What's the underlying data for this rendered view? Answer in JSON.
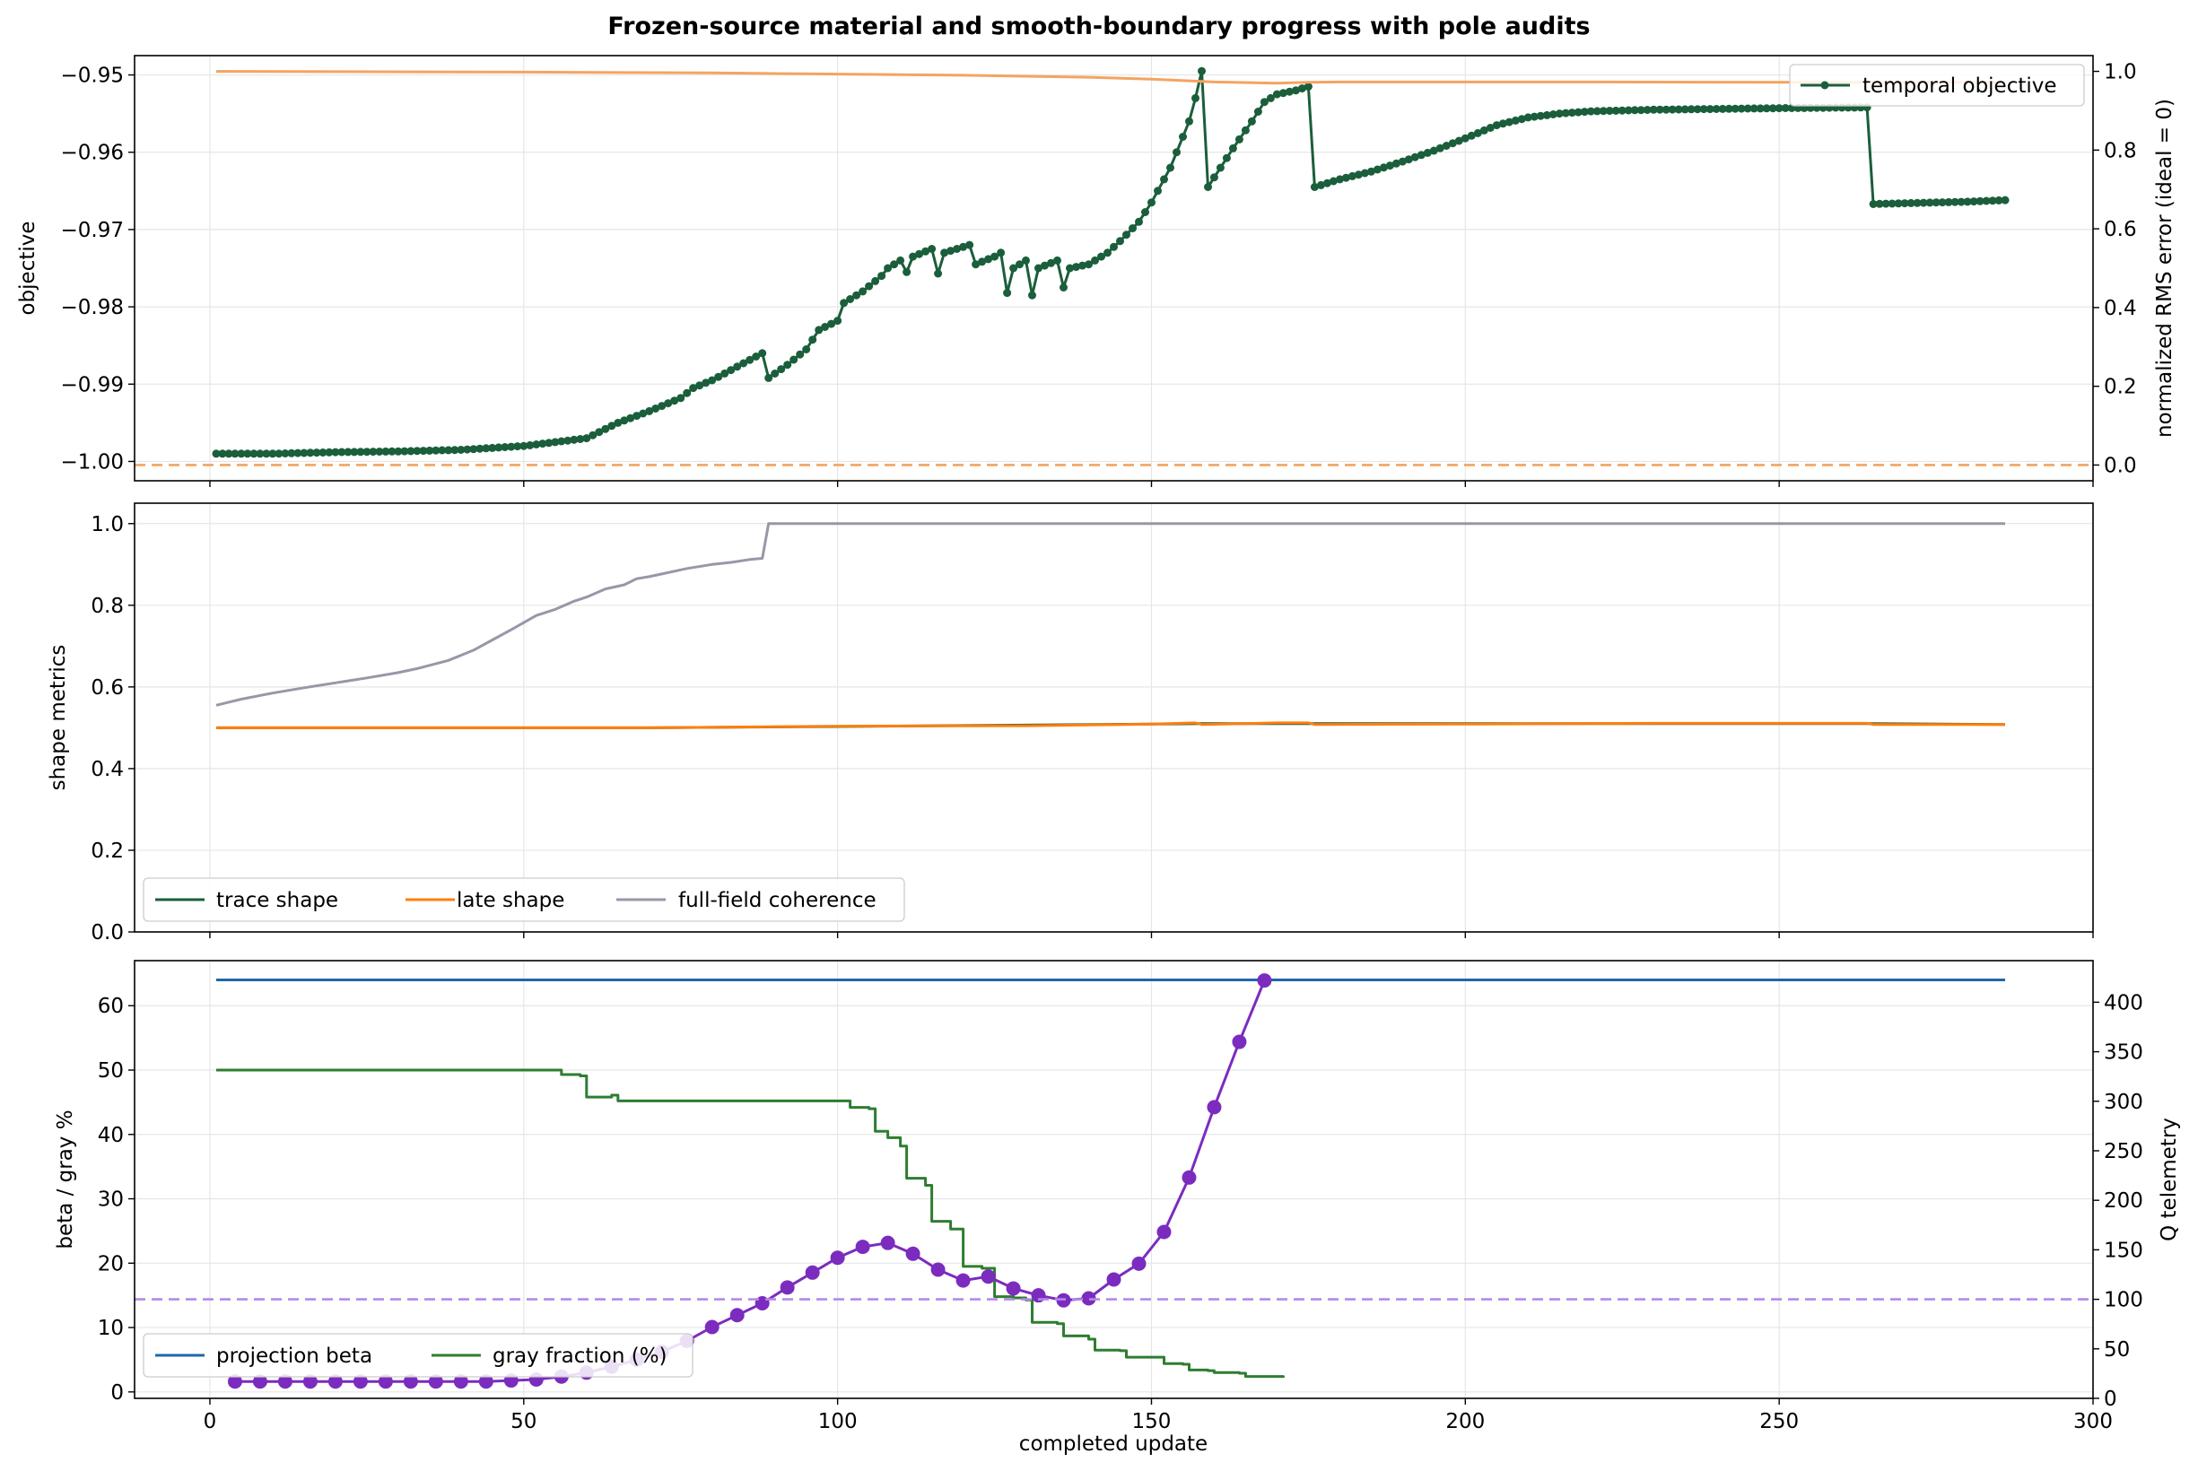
{
  "title": "Frozen-source material and smooth-boundary progress with pole audits",
  "colors": {
    "dark_green": "#1b5e3b",
    "orange": "#ff7f0e",
    "light_orange": "#f4a460",
    "gray": "#9a96a8",
    "blue": "#1f67a8",
    "green": "#2e7d32",
    "purple": "#7b2cbf",
    "light_purple": "#b48ae6"
  },
  "chart_data": [
    {
      "type": "line",
      "panel": "top",
      "xlabel": "",
      "ylabel": "objective",
      "ylabel_right": "normalized RMS error (ideal = 0)",
      "xlim": [
        -12,
        300
      ],
      "ylim": [
        -1.0025,
        -0.9475
      ],
      "ylim_right": [
        -0.04,
        1.04
      ],
      "yticks": [
        -1.0,
        -0.99,
        -0.98,
        -0.97,
        -0.96,
        -0.95
      ],
      "ytick_labels": [
        "−1.00",
        "−0.99",
        "−0.98",
        "−0.97",
        "−0.96",
        "−0.95"
      ],
      "yticks_right": [
        0.0,
        0.2,
        0.4,
        0.6,
        0.8,
        1.0
      ],
      "ytick_labels_right": [
        "0.0",
        "0.2",
        "0.4",
        "0.6",
        "0.8",
        "1.0"
      ],
      "grid": true,
      "legend": {
        "placement": "upper-right",
        "entries": [
          "temporal objective"
        ]
      },
      "series": [
        {
          "name": "temporal objective",
          "axis": "left",
          "style": "line-markers",
          "color": "#1b5e3b",
          "points": [
            [
              1,
              -0.999
            ],
            [
              10,
              -0.999
            ],
            [
              20,
              -0.9988
            ],
            [
              30,
              -0.9987
            ],
            [
              40,
              -0.9985
            ],
            [
              50,
              -0.998
            ],
            [
              55,
              -0.9975
            ],
            [
              60,
              -0.997
            ],
            [
              65,
              -0.995
            ],
            [
              70,
              -0.9935
            ],
            [
              75,
              -0.9918
            ],
            [
              77,
              -0.9905
            ],
            [
              80,
              -0.9895
            ],
            [
              85,
              -0.9873
            ],
            [
              88,
              -0.986
            ],
            [
              89,
              -0.9892
            ],
            [
              92,
              -0.9875
            ],
            [
              95,
              -0.9855
            ],
            [
              97,
              -0.983
            ],
            [
              100,
              -0.9818
            ],
            [
              101,
              -0.9795
            ],
            [
              104,
              -0.978
            ],
            [
              107,
              -0.976
            ],
            [
              108,
              -0.975
            ],
            [
              110,
              -0.974
            ],
            [
              111,
              -0.9755
            ],
            [
              112,
              -0.9735
            ],
            [
              115,
              -0.9725
            ],
            [
              116,
              -0.9757
            ],
            [
              117,
              -0.973
            ],
            [
              121,
              -0.972
            ],
            [
              122,
              -0.9745
            ],
            [
              125,
              -0.9735
            ],
            [
              126,
              -0.973
            ],
            [
              127,
              -0.9782
            ],
            [
              128,
              -0.975
            ],
            [
              130,
              -0.974
            ],
            [
              131,
              -0.9785
            ],
            [
              132,
              -0.975
            ],
            [
              135,
              -0.974
            ],
            [
              136,
              -0.9775
            ],
            [
              137,
              -0.975
            ],
            [
              140,
              -0.9745
            ],
            [
              143,
              -0.973
            ],
            [
              145,
              -0.9715
            ],
            [
              148,
              -0.969
            ],
            [
              150,
              -0.9665
            ],
            [
              153,
              -0.962
            ],
            [
              156,
              -0.956
            ],
            [
              157,
              -0.953
            ],
            [
              158,
              -0.9495
            ],
            [
              159,
              -0.9645
            ],
            [
              161,
              -0.962
            ],
            [
              163,
              -0.9595
            ],
            [
              166,
              -0.956
            ],
            [
              168,
              -0.9535
            ],
            [
              170,
              -0.9525
            ],
            [
              173,
              -0.952
            ],
            [
              175,
              -0.9515
            ],
            [
              176,
              -0.9645
            ],
            [
              180,
              -0.9635
            ],
            [
              185,
              -0.9625
            ],
            [
              190,
              -0.9612
            ],
            [
              195,
              -0.9598
            ],
            [
              200,
              -0.9582
            ],
            [
              205,
              -0.9565
            ],
            [
              210,
              -0.9555
            ],
            [
              215,
              -0.955
            ],
            [
              220,
              -0.9547
            ],
            [
              230,
              -0.9545
            ],
            [
              240,
              -0.9544
            ],
            [
              250,
              -0.9543
            ],
            [
              264,
              -0.9542
            ],
            [
              265,
              -0.9667
            ],
            [
              270,
              -0.9666
            ],
            [
              280,
              -0.9664
            ],
            [
              286,
              -0.9662
            ]
          ]
        },
        {
          "name": "",
          "axis": "right",
          "style": "line",
          "color": "#f4a460",
          "points": [
            [
              1,
              1.0
            ],
            [
              50,
              0.998
            ],
            [
              80,
              0.996
            ],
            [
              100,
              0.993
            ],
            [
              120,
              0.99
            ],
            [
              140,
              0.985
            ],
            [
              150,
              0.98
            ],
            [
              160,
              0.973
            ],
            [
              170,
              0.97
            ],
            [
              175,
              0.972
            ],
            [
              180,
              0.973
            ],
            [
              220,
              0.973
            ],
            [
              265,
              0.972
            ],
            [
              286,
              0.972
            ]
          ]
        },
        {
          "name": "",
          "axis": "right",
          "style": "dashed-hline",
          "color": "#f4a460",
          "value": 0.0
        }
      ]
    },
    {
      "type": "line",
      "panel": "middle",
      "xlabel": "",
      "ylabel": "shape metrics",
      "xlim": [
        -12,
        300
      ],
      "ylim": [
        0.0,
        1.05
      ],
      "yticks": [
        0.0,
        0.2,
        0.4,
        0.6,
        0.8,
        1.0
      ],
      "ytick_labels": [
        "0.0",
        "0.2",
        "0.4",
        "0.6",
        "0.8",
        "1.0"
      ],
      "grid": true,
      "legend": {
        "placement": "lower-left",
        "entries": [
          "trace shape",
          "late shape",
          "full-field coherence"
        ]
      },
      "series": [
        {
          "name": "trace shape",
          "color": "#1b5e3b",
          "points": [
            [
              1,
              0.5
            ],
            [
              70,
              0.5
            ],
            [
              100,
              0.503
            ],
            [
              158,
              0.51
            ],
            [
              175,
              0.51
            ],
            [
              264,
              0.51
            ],
            [
              286,
              0.508
            ]
          ]
        },
        {
          "name": "late shape",
          "color": "#ff7f0e",
          "points": [
            [
              1,
              0.5
            ],
            [
              70,
              0.5
            ],
            [
              100,
              0.504
            ],
            [
              130,
              0.505
            ],
            [
              150,
              0.509
            ],
            [
              157,
              0.512
            ],
            [
              158,
              0.508
            ],
            [
              170,
              0.512
            ],
            [
              175,
              0.512
            ],
            [
              176,
              0.508
            ],
            [
              200,
              0.509
            ],
            [
              230,
              0.511
            ],
            [
              264,
              0.511
            ],
            [
              265,
              0.508
            ],
            [
              286,
              0.508
            ]
          ]
        },
        {
          "name": "full-field coherence",
          "color": "#9a96a8",
          "points": [
            [
              1,
              0.555
            ],
            [
              5,
              0.57
            ],
            [
              10,
              0.585
            ],
            [
              15,
              0.598
            ],
            [
              20,
              0.61
            ],
            [
              25,
              0.622
            ],
            [
              30,
              0.635
            ],
            [
              33,
              0.645
            ],
            [
              38,
              0.665
            ],
            [
              42,
              0.69
            ],
            [
              45,
              0.715
            ],
            [
              48,
              0.74
            ],
            [
              52,
              0.775
            ],
            [
              55,
              0.79
            ],
            [
              58,
              0.81
            ],
            [
              60,
              0.82
            ],
            [
              63,
              0.84
            ],
            [
              66,
              0.85
            ],
            [
              68,
              0.865
            ],
            [
              70,
              0.87
            ],
            [
              73,
              0.88
            ],
            [
              76,
              0.89
            ],
            [
              80,
              0.9
            ],
            [
              83,
              0.905
            ],
            [
              86,
              0.912
            ],
            [
              88,
              0.915
            ],
            [
              89,
              1.0
            ],
            [
              286,
              1.0
            ]
          ]
        }
      ]
    },
    {
      "type": "line",
      "panel": "bottom",
      "xlabel": "completed update",
      "ylabel": "beta / gray %",
      "ylabel_right": "Q telemetry",
      "xlim": [
        -12,
        300
      ],
      "xticks": [
        0,
        50,
        100,
        150,
        200,
        250,
        300
      ],
      "ylim": [
        -1,
        67
      ],
      "ylim_right": [
        0,
        442
      ],
      "yticks": [
        0,
        10,
        20,
        30,
        40,
        50,
        60
      ],
      "ytick_labels": [
        "0",
        "10",
        "20",
        "30",
        "40",
        "50",
        "60"
      ],
      "yticks_right": [
        0,
        50,
        100,
        150,
        200,
        250,
        300,
        350,
        400
      ],
      "ytick_labels_right": [
        "0",
        "50",
        "100",
        "150",
        "200",
        "250",
        "300",
        "350",
        "400"
      ],
      "grid": true,
      "legend": {
        "placement": "lower-left",
        "entries": [
          "projection beta",
          "gray fraction (%)"
        ]
      },
      "series": [
        {
          "name": "projection beta",
          "axis": "left",
          "color": "#1f67a8",
          "points": [
            [
              1,
              64
            ],
            [
              286,
              64
            ]
          ]
        },
        {
          "name": "gray fraction (%)",
          "axis": "left",
          "style": "step",
          "color": "#2e7d32",
          "points": [
            [
              1,
              50
            ],
            [
              55,
              50
            ],
            [
              56,
              49.3
            ],
            [
              59,
              49.1
            ],
            [
              60,
              45.8
            ],
            [
              64,
              46.1
            ],
            [
              65,
              45.2
            ],
            [
              101,
              45.2
            ],
            [
              102,
              44.2
            ],
            [
              105,
              44
            ],
            [
              106,
              40.5
            ],
            [
              108,
              39.5
            ],
            [
              110,
              38.2
            ],
            [
              111,
              33.2
            ],
            [
              114,
              32.1
            ],
            [
              115,
              26.5
            ],
            [
              118,
              25.3
            ],
            [
              120,
              19.5
            ],
            [
              123,
              19.2
            ],
            [
              125,
              14.8
            ],
            [
              128,
              14.6
            ],
            [
              130,
              14.3
            ],
            [
              131,
              10.8
            ],
            [
              135,
              10.6
            ],
            [
              136,
              8.7
            ],
            [
              140,
              8.2
            ],
            [
              141,
              6.5
            ],
            [
              145,
              6.4
            ],
            [
              146,
              5.4
            ],
            [
              151,
              5.4
            ],
            [
              152,
              4.4
            ],
            [
              155,
              4.3
            ],
            [
              156,
              3.4
            ],
            [
              159,
              3.3
            ],
            [
              160,
              3.0
            ],
            [
              164,
              2.9
            ],
            [
              165,
              2.4
            ],
            [
              171,
              2.2
            ]
          ]
        },
        {
          "name": "",
          "axis": "right",
          "style": "line-markers",
          "color": "#7b2cbf",
          "points": [
            [
              4,
              17
            ],
            [
              8,
              17
            ],
            [
              12,
              17
            ],
            [
              16,
              17
            ],
            [
              20,
              17
            ],
            [
              24,
              17
            ],
            [
              28,
              17
            ],
            [
              32,
              17
            ],
            [
              36,
              17
            ],
            [
              40,
              17
            ],
            [
              44,
              17
            ],
            [
              48,
              18
            ],
            [
              52,
              19
            ],
            [
              56,
              22
            ],
            [
              60,
              26
            ],
            [
              64,
              32
            ],
            [
              68,
              39
            ],
            [
              72,
              47
            ],
            [
              76,
              58
            ],
            [
              80,
              72
            ],
            [
              84,
              84
            ],
            [
              88,
              96
            ],
            [
              92,
              112
            ],
            [
              96,
              127
            ],
            [
              100,
              142
            ],
            [
              104,
              153
            ],
            [
              108,
              157
            ],
            [
              112,
              146
            ],
            [
              116,
              130
            ],
            [
              120,
              119
            ],
            [
              124,
              123
            ],
            [
              128,
              111
            ],
            [
              132,
              104
            ],
            [
              136,
              99
            ],
            [
              140,
              101
            ],
            [
              144,
              120
            ],
            [
              148,
              136
            ],
            [
              152,
              168
            ],
            [
              156,
              223
            ],
            [
              160,
              294
            ],
            [
              164,
              360
            ],
            [
              168,
              422
            ]
          ]
        },
        {
          "name": "",
          "axis": "right",
          "style": "dashed-hline",
          "color": "#b48ae6",
          "value": 100
        }
      ]
    }
  ],
  "x_tick_labels": [
    "0",
    "50",
    "100",
    "150",
    "200",
    "250",
    "300"
  ]
}
